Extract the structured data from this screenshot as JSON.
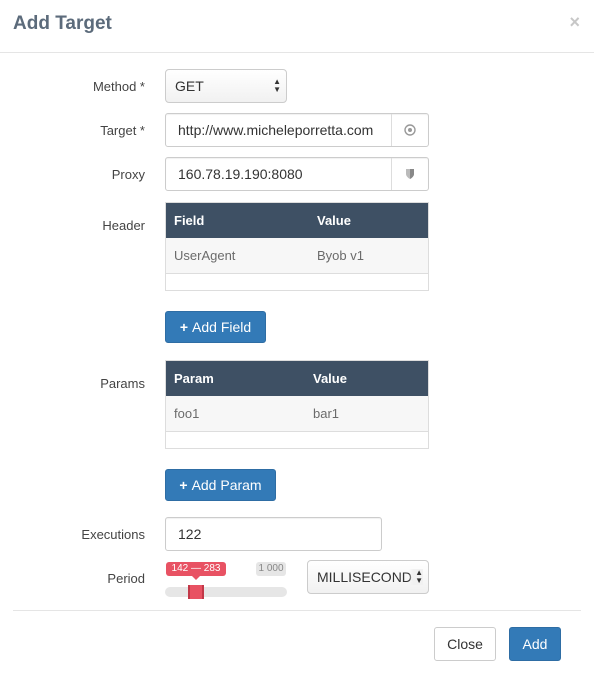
{
  "dialog": {
    "title": "Add Target",
    "close_icon": "×"
  },
  "form": {
    "method": {
      "label": "Method *",
      "value": "GET"
    },
    "target": {
      "label": "Target *",
      "value": "http://www.micheleporretta.com",
      "icon": "target-icon"
    },
    "proxy": {
      "label": "Proxy",
      "value": "160.78.19.190:8080",
      "icon": "shield-icon"
    },
    "header": {
      "label": "Header",
      "columns": [
        "Field",
        "Value"
      ],
      "rows": [
        {
          "field": "UserAgent",
          "value": "Byob v1"
        }
      ],
      "add_button": "Add Field"
    },
    "params": {
      "label": "Params",
      "columns": [
        "Param",
        "Value"
      ],
      "rows": [
        {
          "param": "foo1",
          "value": "bar1"
        }
      ],
      "add_button": "Add Param"
    },
    "executions": {
      "label": "Executions",
      "value": "122"
    },
    "period": {
      "label": "Period",
      "slider": {
        "range_label": "142 — 283",
        "max_label": "1 000",
        "min": 142,
        "max": 283,
        "scale_max": 1000
      },
      "unit": "MILLISECONDS"
    }
  },
  "footer": {
    "close_label": "Close",
    "add_label": "Add"
  },
  "colors": {
    "primary": "#337ab7",
    "table_header": "#3e5064",
    "slider_range": "#e85263",
    "title": "#5c6b7b"
  }
}
